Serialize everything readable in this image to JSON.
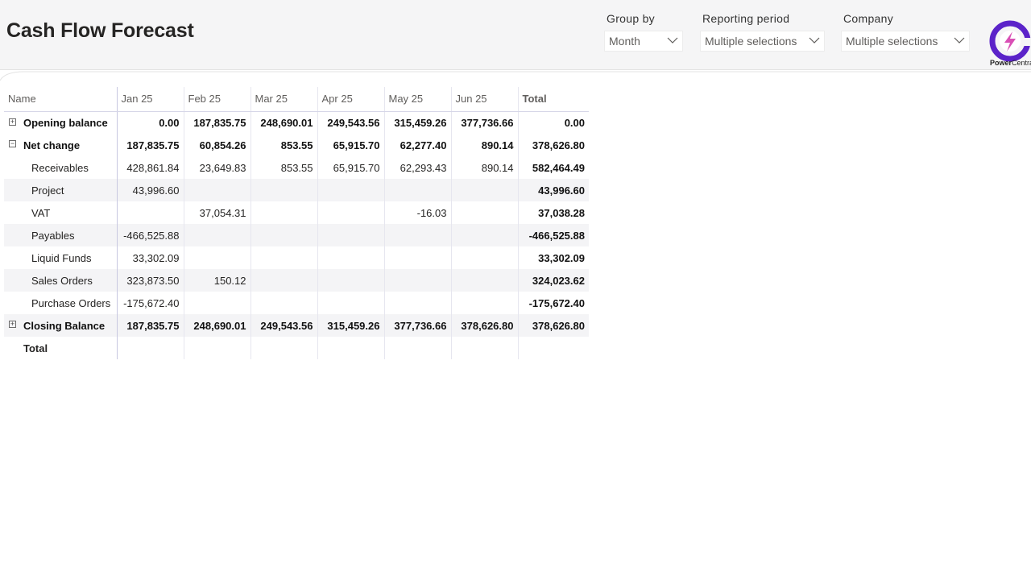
{
  "page": {
    "title": "Cash Flow Forecast"
  },
  "slicers": {
    "group_by": {
      "label": "Group by",
      "value": "Month"
    },
    "reporting_period": {
      "label": "Reporting period",
      "value": "Multiple selections"
    },
    "company": {
      "label": "Company",
      "value": "Multiple selections"
    }
  },
  "logo": {
    "text_bold": "Power",
    "text_rest": "Central",
    "accent_color": "#5b23c9",
    "bolt_color": "#d94fb5"
  },
  "matrix": {
    "columns": [
      "Name",
      "Jan 25",
      "Feb 25",
      "Mar 25",
      "Apr 25",
      "May 25",
      "Jun 25",
      "Total"
    ],
    "rows": [
      {
        "name": "Opening balance",
        "expander": "⊞",
        "values": [
          "0.00",
          "187,835.75",
          "248,690.01",
          "249,543.56",
          "315,459.26",
          "377,736.66"
        ],
        "total": "0.00"
      },
      {
        "name": "Net change",
        "expander": "⊟",
        "values": [
          "187,835.75",
          "60,854.26",
          "853.55",
          "65,915.70",
          "62,277.40",
          "890.14"
        ],
        "total": "378,626.80"
      },
      {
        "name": "Receivables",
        "values": [
          "428,861.84",
          "23,649.83",
          "853.55",
          "65,915.70",
          "62,293.43",
          "890.14"
        ],
        "total": "582,464.49"
      },
      {
        "name": "Project",
        "values": [
          "43,996.60",
          "",
          "",
          "",
          "",
          ""
        ],
        "total": "43,996.60"
      },
      {
        "name": "VAT",
        "values": [
          "",
          "37,054.31",
          "",
          "",
          "-16.03",
          ""
        ],
        "total": "37,038.28"
      },
      {
        "name": "Payables",
        "values": [
          "-466,525.88",
          "",
          "",
          "",
          "",
          ""
        ],
        "total": "-466,525.88"
      },
      {
        "name": "Liquid Funds",
        "values": [
          "33,302.09",
          "",
          "",
          "",
          "",
          ""
        ],
        "total": "33,302.09"
      },
      {
        "name": "Sales Orders",
        "values": [
          "323,873.50",
          "150.12",
          "",
          "",
          "",
          ""
        ],
        "total": "324,023.62"
      },
      {
        "name": "Purchase Orders",
        "values": [
          "-175,672.40",
          "",
          "",
          "",
          "",
          ""
        ],
        "total": "-175,672.40"
      },
      {
        "name": "Closing Balance",
        "expander": "⊞",
        "values": [
          "187,835.75",
          "248,690.01",
          "249,543.56",
          "315,459.26",
          "377,736.66",
          "378,626.80"
        ],
        "total": "378,626.80"
      },
      {
        "name": "Total",
        "values": [
          "",
          "",
          "",
          "",
          "",
          ""
        ],
        "total": ""
      }
    ]
  }
}
